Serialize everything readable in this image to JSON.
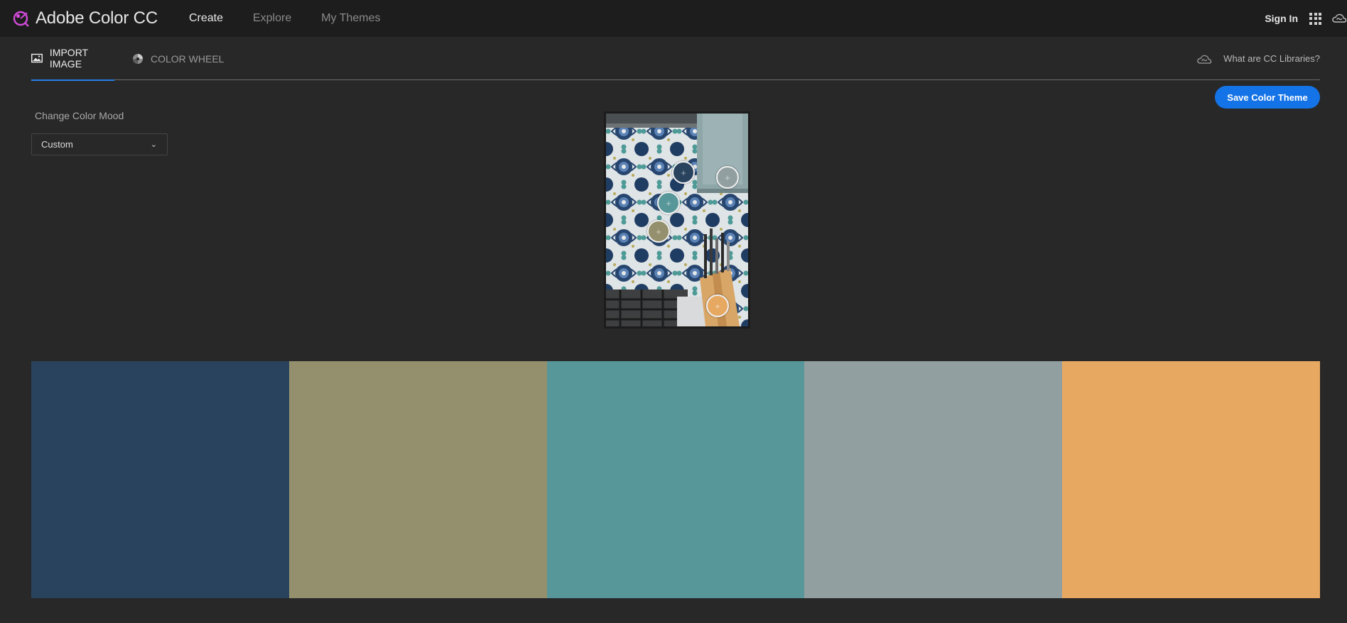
{
  "app": {
    "title": "Adobe Color CC",
    "nav": [
      {
        "label": "Create",
        "active": true
      },
      {
        "label": "Explore",
        "active": false
      },
      {
        "label": "My Themes",
        "active": false
      }
    ],
    "sign_in": "Sign In",
    "icons": {
      "logo": "adobe-color-logo-icon",
      "apps": "app-grid-icon",
      "cc": "creative-cloud-icon"
    }
  },
  "tabs": {
    "import_image": "IMPORT IMAGE",
    "color_wheel": "COLOR WHEEL",
    "cc_libraries": "What are CC Libraries?"
  },
  "save_button": "Save Color Theme",
  "mood": {
    "label": "Change Color Mood",
    "selected": "Custom"
  },
  "theme": {
    "colors": [
      "#29435E",
      "#948F6C",
      "#57979A",
      "#919FA0",
      "#E7A862"
    ],
    "accent": "#1473E6"
  }
}
